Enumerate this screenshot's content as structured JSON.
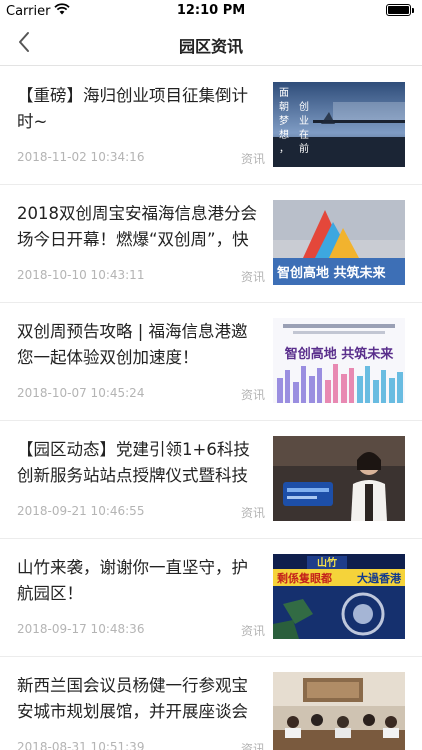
{
  "status_bar": {
    "carrier": "Carrier",
    "time": "12:10 PM",
    "battery_level": 1.0
  },
  "nav": {
    "title": "园区资讯",
    "back_icon": "chevron-left-icon"
  },
  "news": [
    {
      "title": "【重磅】海归创业项目征集倒计时~",
      "date": "2018-11-02 10:34:16",
      "category": "资讯",
      "thumb_text": [
        "面",
        "朝",
        "梦",
        "想",
        "，",
        "创",
        "业",
        "在",
        "前"
      ]
    },
    {
      "title": "2018双创周宝安福海信息港分会场今日开幕！燃爆“双创周”，快",
      "date": "2018-10-10 10:43:11",
      "category": "资讯",
      "thumb_text": [
        "智创高地 共筑未来"
      ]
    },
    {
      "title": "双创周预告攻略 | 福海信息港邀您一起体验双创加速度！",
      "date": "2018-10-07 10:45:24",
      "category": "资讯",
      "thumb_text": [
        "智创高地 共筑未来"
      ]
    },
    {
      "title": "【园区动态】党建引领1+6科技创新服务站站点授牌仪式暨科技",
      "date": "2018-09-21 10:46:55",
      "category": "资讯",
      "thumb_text": []
    },
    {
      "title": "山竹来袭，谢谢你一直坚守，护航园区！",
      "date": "2018-09-17 10:48:36",
      "category": "资讯",
      "thumb_text": [
        "山竹",
        "剩係隻眼都",
        "大過香港"
      ]
    },
    {
      "title": "新西兰国会议员杨健一行参观宝安城市规划展馆，并开展座谈会",
      "date": "2018-08-31 10:51:39",
      "category": "资讯",
      "thumb_text": []
    }
  ]
}
